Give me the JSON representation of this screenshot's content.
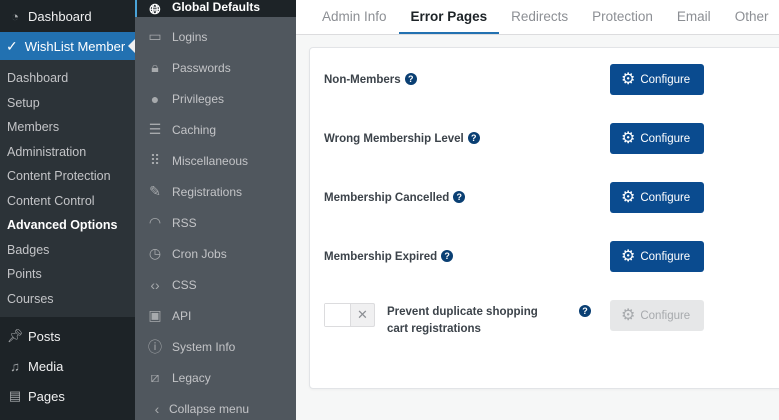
{
  "wp_menu": {
    "dashboard": "Dashboard",
    "active": "WishList Member",
    "submenu": [
      "Dashboard",
      "Setup",
      "Members",
      "Administration",
      "Content Protection",
      "Content Control",
      "Advanced Options",
      "Badges",
      "Points",
      "Courses"
    ],
    "current_submenu_index": 6,
    "bottom": [
      "Posts",
      "Media",
      "Pages"
    ]
  },
  "wl_nav": {
    "items": [
      {
        "label": "Global Defaults",
        "icon": "globe-icon"
      },
      {
        "label": "Logins",
        "icon": "login-icon"
      },
      {
        "label": "Passwords",
        "icon": "lock-icon"
      },
      {
        "label": "Privileges",
        "icon": "user-icon"
      },
      {
        "label": "Caching",
        "icon": "caching-icon"
      },
      {
        "label": "Miscellaneous",
        "icon": "grid-icon"
      },
      {
        "label": "Registrations",
        "icon": "pencil-icon"
      },
      {
        "label": "RSS",
        "icon": "rss-icon"
      },
      {
        "label": "Cron Jobs",
        "icon": "clock-icon"
      },
      {
        "label": "CSS",
        "icon": "code-icon"
      },
      {
        "label": "API",
        "icon": "api-icon"
      },
      {
        "label": "System Info",
        "icon": "info-icon"
      },
      {
        "label": "Legacy",
        "icon": "legacy-icon"
      }
    ],
    "collapse": "Collapse menu"
  },
  "tabs": [
    "Admin Info",
    "Error Pages",
    "Redirects",
    "Protection",
    "Email",
    "Other"
  ],
  "active_tab_index": 1,
  "rows": [
    {
      "label": "Non-Members"
    },
    {
      "label": "Wrong Membership Level"
    },
    {
      "label": "Membership Cancelled"
    },
    {
      "label": "Membership Expired"
    }
  ],
  "configure_label": "Configure",
  "duplicate": {
    "label": "Prevent duplicate shopping cart registrations",
    "toggle": "off",
    "toggle_symbol": "✕"
  },
  "help_symbol": "?",
  "colors": {
    "accent": "#2271b1",
    "button": "#0a4b8f",
    "help": "#0a3f73"
  }
}
